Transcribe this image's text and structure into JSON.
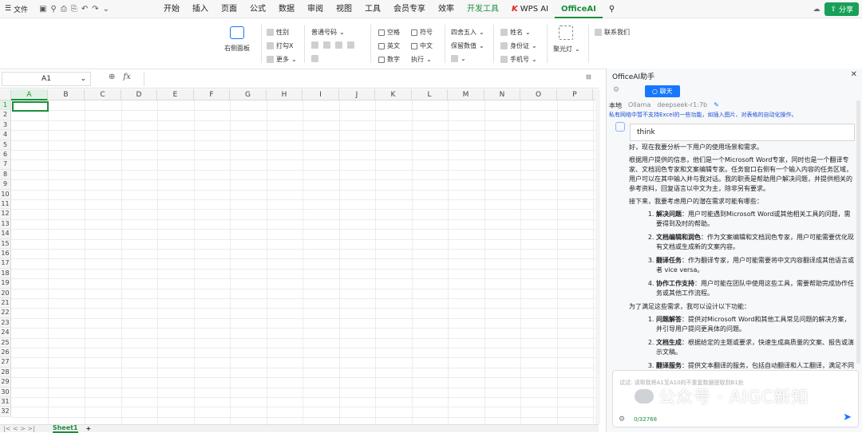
{
  "menubar": {
    "file": "文件",
    "tabs": [
      "开始",
      "插入",
      "页面",
      "公式",
      "数据",
      "审阅",
      "视图",
      "工具",
      "会员专享",
      "效率"
    ],
    "dev_tab": "开发工具",
    "wps_ai": "WPS AI",
    "officeai": "OfficeAI",
    "share": "分享"
  },
  "ribbon": {
    "right_panel": "右侧面板",
    "g1": [
      "性别",
      "打勾X",
      "更多"
    ],
    "g2_title": "普通号码",
    "g3": [
      "空格",
      "符号",
      "英文",
      "中文",
      "数字",
      "执行"
    ],
    "g4": [
      "四舍五入",
      "保留数值"
    ],
    "g5": [
      "姓名",
      "身份证",
      "手机号"
    ],
    "spotlight": "聚光灯",
    "contact": "联系我们"
  },
  "formula": {
    "cell": "A1",
    "fx": "fx"
  },
  "columns": [
    "A",
    "B",
    "C",
    "D",
    "E",
    "F",
    "G",
    "H",
    "I",
    "J",
    "K",
    "L",
    "M",
    "N",
    "O",
    "P"
  ],
  "rows": [
    "1",
    "2",
    "3",
    "4",
    "5",
    "6",
    "7",
    "8",
    "9",
    "10",
    "11",
    "12",
    "13",
    "14",
    "15",
    "16",
    "17",
    "18",
    "19",
    "20",
    "21",
    "22",
    "23",
    "24",
    "25",
    "26",
    "27",
    "28",
    "29",
    "30",
    "31",
    "32"
  ],
  "sheet": {
    "tab": "Sheet1",
    "add": "+"
  },
  "panel": {
    "title": "OfficeAI助手",
    "chat": "聊天",
    "models": [
      "本地",
      "Ollama",
      "deepseek-r1:7b"
    ],
    "warning": "私有网络中暂不支持Excel的一些功能，如插入图片、对表格的自动化操作。",
    "think": "think",
    "p1": "好，现在我要分析一下用户的使用场景和需求。",
    "p2": "根据用户提供的信息，他们是一个Microsoft Word专家，同时也是一个翻译专家、文档润色专家和文案编辑专家。任务窗口右侧有一个输入内容的任务区域，用户可以在其中输入并与我对话。我的职责是帮助用户解决问题，并提供相关的参考资料，回复语言以中文为主，除非另有要求。",
    "p3": "接下来，我要考虑用户的潜在需求可能有哪些：",
    "list1": [
      {
        "t": "解决问题",
        "d": "：用户可能遇到Microsoft Word或其他相关工具的问题，需要得到及时的帮助。"
      },
      {
        "t": "文档编辑和润色",
        "d": "：作为文案编辑和文档润色专家，用户可能需要优化现有文档或生成新的文案内容。"
      },
      {
        "t": "翻译任务",
        "d": "：作为翻译专家，用户可能需要将中文内容翻译成其他语言或者 vice versa。"
      },
      {
        "t": "协作工作支持",
        "d": "：用户可能在团队中使用这些工具，需要帮助完成协作任务或其他工作流程。"
      }
    ],
    "p4": "为了满足这些需求，我可以设计以下功能：",
    "list2": [
      {
        "t": "问题解答",
        "d": "：提供对Microsoft Word和其他工具常见问题的解决方案，并引导用户提问更具体的问题。"
      },
      {
        "t": "文档生成",
        "d": "：根据给定的主题或要求，快速生成高质量的文案、报告或演示文稿。"
      },
      {
        "t": "翻译服务",
        "d": "：提供文本翻译的服务，包括自动翻译和人工翻译，满足不同语言需求。"
      }
    ],
    "input_placeholder": "试试: 请帮我将A1至A10的不重复数据提取到B1处",
    "counter": "0/32768"
  },
  "watermark": "公众号 · AIGC新知"
}
